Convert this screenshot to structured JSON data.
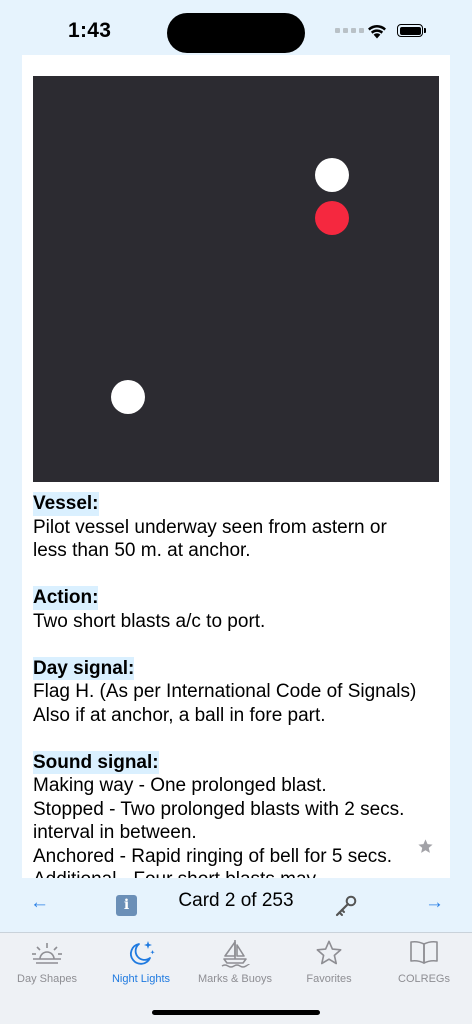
{
  "status_bar": {
    "time": "1:43"
  },
  "card": {
    "lights": [
      {
        "color": "white"
      },
      {
        "color": "red"
      },
      {
        "color": "white"
      }
    ],
    "sections": [
      {
        "heading": "Vessel:",
        "lines": [
          "Pilot vessel underway seen from astern or",
          "less than 50 m. at anchor."
        ]
      },
      {
        "heading": "Action:",
        "lines": [
          "Two short blasts a/c to port."
        ]
      },
      {
        "heading": "Day signal:",
        "lines": [
          "Flag H. (As per International Code of Signals)",
          "Also if at anchor, a ball in fore part."
        ]
      },
      {
        "heading": "Sound signal:",
        "lines": [
          "Making way - One prolonged blast.",
          "Stopped - Two prolonged blasts with 2 secs.",
          "interval in between.",
          "Anchored - Rapid ringing of bell for 5 secs.",
          "Additional - Four short blasts may"
        ]
      }
    ]
  },
  "card_nav": {
    "prev": "←",
    "info": "i",
    "counter": "Card 2 of 253",
    "next": "→"
  },
  "tabs": [
    {
      "label": "Day Shapes",
      "icon": "sunrise-icon",
      "active": false
    },
    {
      "label": "Night Lights",
      "icon": "moon-stars-icon",
      "active": true
    },
    {
      "label": "Marks & Buoys",
      "icon": "sailboat-icon",
      "active": false
    },
    {
      "label": "Favorites",
      "icon": "star-icon",
      "active": false
    },
    {
      "label": "COLREGs",
      "icon": "book-icon",
      "active": false
    }
  ],
  "colors": {
    "accent": "#1f7ae0",
    "panel": "#2c2b31",
    "red_light": "#f5283f",
    "heading_bg": "#daf0ff"
  }
}
